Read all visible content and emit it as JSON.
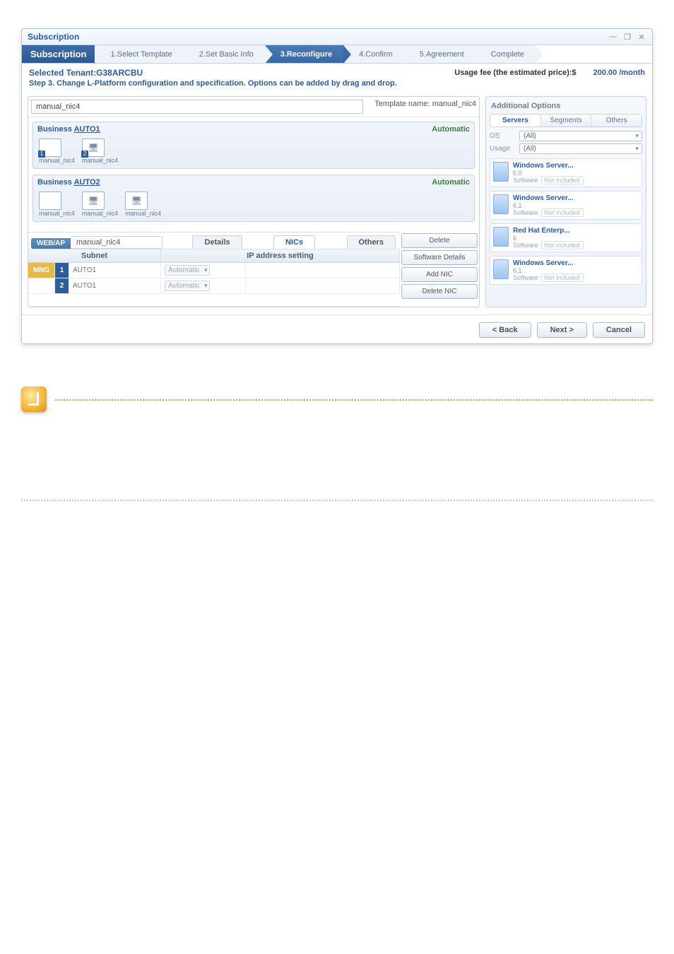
{
  "window": {
    "title": "Subscription"
  },
  "wizard": {
    "title": "Subscription",
    "steps": [
      "1.Select Template",
      "2.Set Basic Info",
      "3.Reconfigure",
      "4.Confirm",
      "5.Agreement",
      "Complete"
    ]
  },
  "tenant": {
    "label": "Selected Tenant:G38ARCBU"
  },
  "usage": {
    "label": "Usage fee (the estimated price):$",
    "price": "200.00 /month"
  },
  "step_desc": "Step 3. Change L-Platform configuration and specification. Options can be added by drag and drop.",
  "template": {
    "name_value": "manual_nic4",
    "name_label": "Template name: manual_nic4"
  },
  "segments": [
    {
      "label_pre": "Business ",
      "label_link": "AUTO1",
      "tag": "Automatic",
      "nodes": [
        {
          "idx": "1",
          "cap": "manual_nic4",
          "type": "box"
        },
        {
          "idx": "2",
          "cap": "manual_nic4",
          "type": "server"
        }
      ]
    },
    {
      "label_pre": "Business ",
      "label_link": "AUTO2",
      "tag": "Automatic",
      "nodes": [
        {
          "idx": "",
          "cap": "manual_nic4",
          "type": "box"
        },
        {
          "idx": "",
          "cap": "manual_nic4",
          "type": "server"
        },
        {
          "idx": "",
          "cap": "manual_nic4",
          "type": "server"
        }
      ]
    }
  ],
  "detail": {
    "badge": "WEB/AP",
    "server_name": "manual_nic4",
    "tabs": [
      "Details",
      "NICs",
      "Others"
    ],
    "side_buttons": [
      "Delete",
      "Software Details",
      "Add NIC",
      "Delete NIC"
    ],
    "nic_headers": {
      "subnet": "Subnet",
      "ip": "IP address setting"
    },
    "nic_rows": [
      {
        "lbl": "MNG",
        "idx": "1",
        "name": "AUTO1",
        "mode": "Automatic",
        "ip": ""
      },
      {
        "lbl": "",
        "idx": "2",
        "name": "AUTO1",
        "mode": "Automatic",
        "ip": ""
      }
    ]
  },
  "right_panel": {
    "title": "Additional Options",
    "tabs": [
      "Servers",
      "Segments",
      "Others"
    ],
    "filters": {
      "os_label": "OS",
      "os_value": "(All)",
      "usage_label": "Usage",
      "usage_value": "(All)"
    },
    "servers": [
      {
        "name": "Windows Server...",
        "sub": "5.0",
        "sw_label": "Software",
        "sw_value": "Not included"
      },
      {
        "name": "Windows Server...",
        "sub": "6.1",
        "sw_label": "Software",
        "sw_value": "Not included"
      },
      {
        "name": "Red Hat Enterp...",
        "sub": "6",
        "sw_label": "Software",
        "sw_value": "Not included"
      },
      {
        "name": "Windows Server...",
        "sub": "6.1",
        "sw_label": "Software",
        "sw_value": "Not included"
      }
    ]
  },
  "footer": {
    "back": "< Back",
    "next": "Next >",
    "cancel": "Cancel"
  }
}
